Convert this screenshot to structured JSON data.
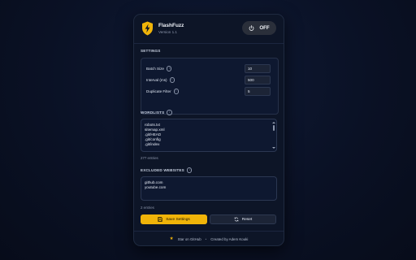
{
  "app": {
    "name": "FlashFuzz",
    "version": "Version 1.1"
  },
  "power": {
    "label": "OFF"
  },
  "settings": {
    "title": "SETTINGS",
    "rows": [
      {
        "label": "Batch Size",
        "value": "10"
      },
      {
        "label": "Interval (ms)",
        "value": "500"
      },
      {
        "label": "Duplicate Filter",
        "value": "5"
      }
    ]
  },
  "wordlists": {
    "title": "WORDLISTS",
    "entries": [
      "robots.txt",
      "sitemap.xml",
      ".git/HEAD",
      ".git/config",
      ".git/index"
    ],
    "count": "277 entries"
  },
  "excluded": {
    "title": "EXCLUDED WEBSITES",
    "entries": [
      "github.com",
      "youtube.com"
    ],
    "count": "2 entries"
  },
  "buttons": {
    "save": "Save Settings",
    "reset": "Reset"
  },
  "footer": {
    "star": "Star on GitHub",
    "separator": "•",
    "credit": "Created by Adem Kouki"
  },
  "colors": {
    "accent": "#f0b409",
    "background": "#0d1527"
  }
}
